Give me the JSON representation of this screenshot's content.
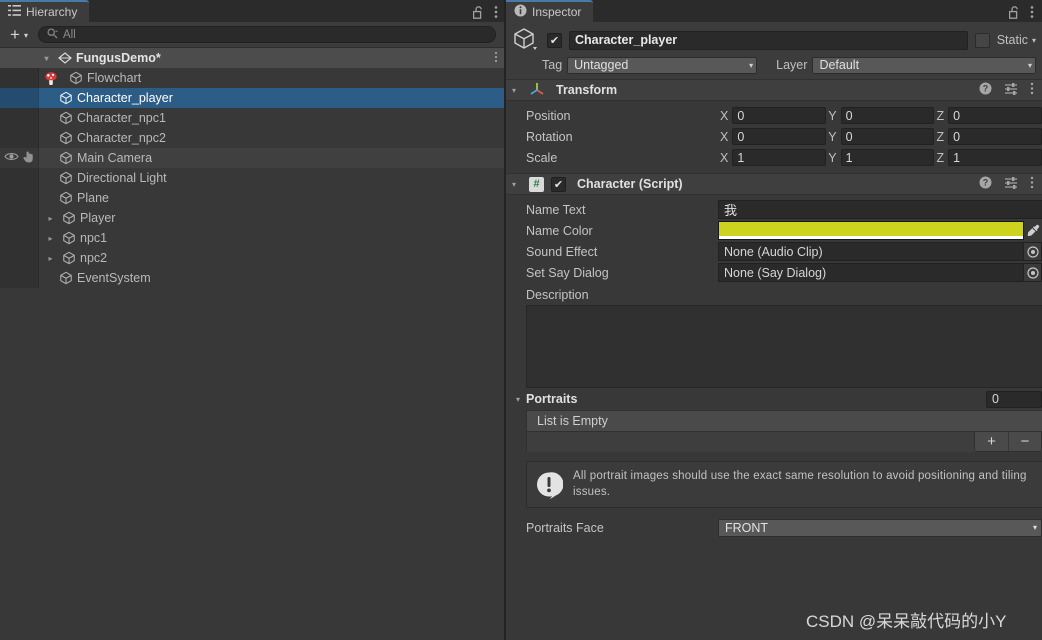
{
  "hierarchy": {
    "tab_label": "Hierarchy",
    "tab_icon": "hierarchy-list-icon",
    "lock_icon": "lock-open-icon",
    "menu_icon": "kebab-menu-icon",
    "toolbar": {
      "add_label": "+",
      "add_caret": "▾",
      "search_icon": "search-icon",
      "search_value": "",
      "search_placeholder": "All"
    },
    "items": [
      {
        "label": "FungusDemo*",
        "type": "scene",
        "icon": "scene-icon",
        "foldout": "▾",
        "indent": 0,
        "selected": false,
        "kebab": "⋮"
      },
      {
        "label": "Flowchart",
        "type": "gameobject",
        "icon": "gameobject-cube-icon",
        "badge": "fungus-mushroom-icon",
        "indent": 1,
        "selected": false
      },
      {
        "label": "Character_player",
        "type": "gameobject",
        "icon": "gameobject-cube-icon",
        "indent": 1,
        "selected": true
      },
      {
        "label": "Character_npc1",
        "type": "gameobject",
        "icon": "gameobject-cube-icon",
        "indent": 1,
        "selected": false
      },
      {
        "label": "Character_npc2",
        "type": "gameobject",
        "icon": "gameobject-cube-icon",
        "indent": 1,
        "selected": false
      },
      {
        "label": "Main Camera",
        "type": "gameobject",
        "icon": "gameobject-cube-icon",
        "indent": 1,
        "selected": false,
        "hovered": true,
        "visibility_icon": "eye-icon",
        "pickability_icon": "hand-pointer-icon"
      },
      {
        "label": "Directional Light",
        "type": "gameobject",
        "icon": "gameobject-cube-icon",
        "indent": 1,
        "selected": false
      },
      {
        "label": "Plane",
        "type": "gameobject",
        "icon": "gameobject-cube-icon",
        "indent": 1,
        "selected": false
      },
      {
        "label": "Player",
        "type": "gameobject",
        "icon": "gameobject-cube-icon",
        "foldout": "▸",
        "indent": 1,
        "selected": false
      },
      {
        "label": "npc1",
        "type": "gameobject",
        "icon": "gameobject-cube-icon",
        "foldout": "▸",
        "indent": 1,
        "selected": false
      },
      {
        "label": "npc2",
        "type": "gameobject",
        "icon": "gameobject-cube-icon",
        "foldout": "▸",
        "indent": 1,
        "selected": false
      },
      {
        "label": "EventSystem",
        "type": "gameobject",
        "icon": "gameobject-cube-icon",
        "indent": 1,
        "selected": false
      }
    ]
  },
  "inspector": {
    "tab_label": "Inspector",
    "tab_icon": "info-circle-icon",
    "lock_icon": "lock-open-icon",
    "menu_icon": "kebab-menu-icon",
    "gameobject": {
      "icon": "gameobject-cube-icon",
      "enabled_checkmark": "✔",
      "name": "Character_player",
      "static_label": "Static",
      "static_caret": "▾",
      "tag_label": "Tag",
      "tag_value": "Untagged",
      "layer_label": "Layer",
      "layer_value": "Default",
      "caret": "▾"
    },
    "components": [
      {
        "title": "Transform",
        "icon": "transform-axis-icon",
        "foldout": "▾",
        "help_icon": "help-circle-icon",
        "preset_icon": "preset-sliders-icon",
        "menu_icon": "kebab-menu-icon",
        "rows": [
          {
            "label": "Position",
            "axes": [
              {
                "axis": "X",
                "value": "0"
              },
              {
                "axis": "Y",
                "value": "0"
              },
              {
                "axis": "Z",
                "value": "0"
              }
            ]
          },
          {
            "label": "Rotation",
            "axes": [
              {
                "axis": "X",
                "value": "0"
              },
              {
                "axis": "Y",
                "value": "0"
              },
              {
                "axis": "Z",
                "value": "0"
              }
            ]
          },
          {
            "label": "Scale",
            "axes": [
              {
                "axis": "X",
                "value": "1"
              },
              {
                "axis": "Y",
                "value": "1"
              },
              {
                "axis": "Z",
                "value": "1"
              }
            ]
          }
        ]
      },
      {
        "title": "Character (Script)",
        "icon": "cs-script-icon",
        "script_glyph": "#",
        "foldout": "▾",
        "enabled_checkmark": "✔",
        "help_icon": "help-circle-icon",
        "preset_icon": "preset-sliders-icon",
        "menu_icon": "kebab-menu-icon",
        "fields": {
          "name_text_label": "Name Text",
          "name_text_value": "我",
          "name_color_label": "Name Color",
          "name_color_value": "#CDD21E",
          "eyedropper_icon": "eyedropper-icon",
          "sound_effect_label": "Sound Effect",
          "sound_effect_value": "None (Audio Clip)",
          "set_say_dialog_label": "Set Say Dialog",
          "set_say_dialog_value": "None (Say Dialog)",
          "object_picker_icon": "object-picker-icon",
          "description_label": "Description",
          "description_value": ""
        },
        "portraits": {
          "foldout": "▾",
          "label": "Portraits",
          "size_value": "0",
          "empty_label": "List is Empty",
          "add_label": "+",
          "remove_label": "−"
        },
        "helpbox": {
          "icon": "warning-exclamation-icon",
          "text": "All portrait images should use the exact same resolution to avoid positioning and tiling issues."
        },
        "portraits_face": {
          "label": "Portraits Face",
          "value": "FRONT",
          "caret": "▾"
        }
      }
    ]
  },
  "watermark": {
    "text": "CSDN @呆呆敲代码的小Y"
  }
}
